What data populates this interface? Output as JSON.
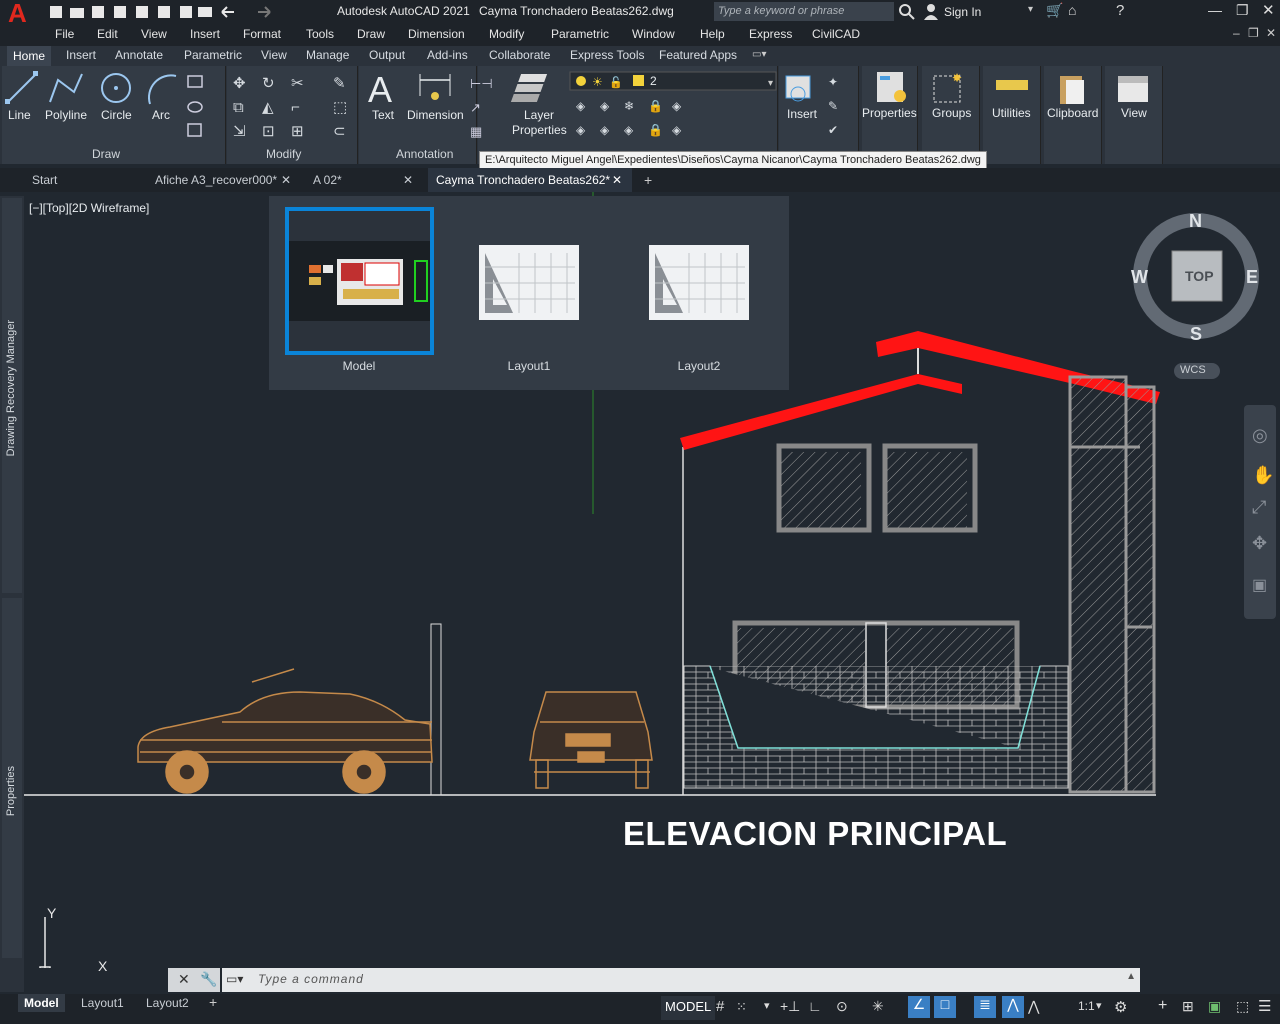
{
  "app": {
    "title": "Autodesk AutoCAD 2021",
    "file": "Cayma Tronchadero Beatas262.dwg",
    "search_placeholder": "Type a keyword or phrase",
    "sign_in": "Sign In",
    "logo_letter": "A"
  },
  "menu": [
    "File",
    "Edit",
    "View",
    "Insert",
    "Format",
    "Tools",
    "Draw",
    "Dimension",
    "Modify",
    "Parametric",
    "Window",
    "Help",
    "Express",
    "CivilCAD"
  ],
  "ribbon_tabs": [
    "Home",
    "Insert",
    "Annotate",
    "Parametric",
    "View",
    "Manage",
    "Output",
    "Add-ins",
    "Collaborate",
    "Express Tools",
    "Featured Apps"
  ],
  "ribbon": {
    "draw_tools": [
      "Line",
      "Polyline",
      "Circle",
      "Arc"
    ],
    "draw_panel": "Draw",
    "modify_panel": "Modify",
    "text": "Text",
    "dimension": "Dimension",
    "annotation_panel": "Annotation",
    "layer_properties_1": "Layer",
    "layer_properties_2": "Properties",
    "layer_value": "2",
    "insert": "Insert",
    "properties": "Properties",
    "groups": "Groups",
    "utilities": "Utilities",
    "clipboard": "Clipboard",
    "view": "View"
  },
  "tooltip_path": "E:\\Arquitecto Miguel Angel\\Expedientes\\Diseños\\Cayma Nicanor\\Cayma Tronchadero Beatas262.dwg",
  "doc_tabs": [
    {
      "label": "Start",
      "close": false
    },
    {
      "label": "Afiche A3_recover000*",
      "close": true
    },
    {
      "label": "A 02*",
      "close": true
    },
    {
      "label": "Cayma Tronchadero Beatas262*",
      "close": true
    }
  ],
  "viewport_label": "[−][Top][2D Wireframe]",
  "thumbs": [
    "Model",
    "Layout1",
    "Layout2"
  ],
  "viewcube": {
    "n": "N",
    "s": "S",
    "e": "E",
    "w": "W",
    "top": "TOP",
    "wcs": "WCS"
  },
  "side_labels": {
    "recovery": "Drawing Recovery Manager",
    "properties": "Properties"
  },
  "drawing_title": "ELEVACION PRINCIPAL",
  "ucs": {
    "x": "X",
    "y": "Y"
  },
  "command_placeholder": "Type a command",
  "layout_tabs": [
    "Model",
    "Layout1",
    "Layout2"
  ],
  "status": {
    "model": "MODEL",
    "scale": "1:1"
  },
  "colors": {
    "roof": "#ff0000",
    "car": "#c58a4a",
    "wall": "#d8d8d8",
    "accent": "#0a84d8"
  }
}
